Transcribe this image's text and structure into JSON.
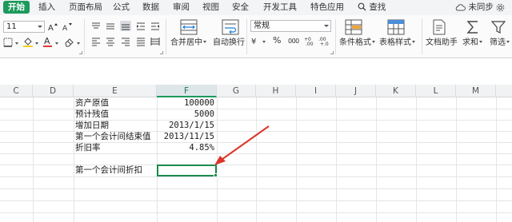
{
  "menu": {
    "tabs": [
      "开始",
      "插入",
      "页面布局",
      "公式",
      "数据",
      "审阅",
      "视图",
      "安全",
      "开发工具",
      "特色应用"
    ],
    "search_label": "查找",
    "sync_label": "未同步"
  },
  "ribbon": {
    "font_size": "11",
    "number_format": "常规",
    "merge_label": "合并居中",
    "wrap_label": "自动换行",
    "conditional_format_label": "条件格式",
    "table_style_label": "表格样式",
    "doc_helper_label": "文档助手",
    "sum_label": "求和",
    "filter_label": "筛选",
    "percent_symbol": "%",
    "thousands_symbol": "000",
    "font_color_letter": "A",
    "accent_color": "#1c9a5c",
    "font_color_bar": "#e03a2f",
    "fill_color_bar": "#f3d020"
  },
  "sheet": {
    "columns": [
      "C",
      "D",
      "E",
      "F",
      "G",
      "H",
      "I",
      "J",
      "K",
      "L",
      "M"
    ],
    "selected_column": "F",
    "rows": [
      {
        "label": "资产原值",
        "value": "100000"
      },
      {
        "label": "预计残值",
        "value": "5000"
      },
      {
        "label": "增加日期",
        "value": "2013/1/15"
      },
      {
        "label": "第一个会计间结束值",
        "value": "2013/11/15"
      },
      {
        "label": "折旧率",
        "value": "4.85%"
      }
    ],
    "target_label": "第一个会计间折扣",
    "target_value": "",
    "arrow_color": "#d9362b"
  }
}
